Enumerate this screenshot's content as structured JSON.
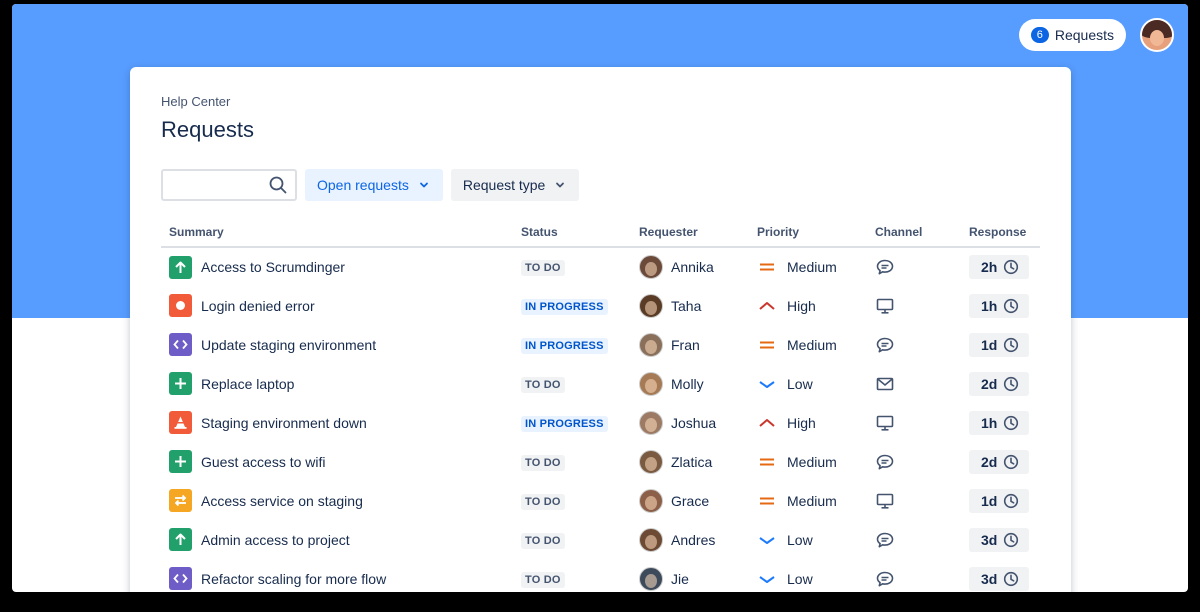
{
  "header": {
    "requests_count": "6",
    "requests_label": "Requests"
  },
  "breadcrumb": "Help Center",
  "page_title": "Requests",
  "filters": {
    "search_placeholder": "",
    "open_requests_label": "Open requests",
    "request_type_label": "Request type"
  },
  "columns": [
    "Summary",
    "Status",
    "Requester",
    "Priority",
    "Channel",
    "Response"
  ],
  "colors": {
    "hero": "#579dff",
    "accent": "#0c66e4"
  },
  "rows": [
    {
      "type_icon": "arrow-up-icon",
      "type_color": "#22a06b",
      "summary": "Access to Scrumdinger",
      "status": "TO DO",
      "status_kind": "todo",
      "requester": "Annika",
      "avatar_color": "#6b4a3a",
      "priority": "Medium",
      "channel_icon": "chat-icon",
      "response": "2h"
    },
    {
      "type_icon": "circle-icon",
      "type_color": "#f15b3a",
      "summary": "Login denied error",
      "status": "IN PROGRESS",
      "status_kind": "progress",
      "requester": "Taha",
      "avatar_color": "#5a3b26",
      "priority": "High",
      "channel_icon": "monitor-icon",
      "response": "1h"
    },
    {
      "type_icon": "code-icon",
      "type_color": "#6e5dc6",
      "summary": "Update staging environment",
      "status": "IN PROGRESS",
      "status_kind": "progress",
      "requester": "Fran",
      "avatar_color": "#8a6f5a",
      "priority": "Medium",
      "channel_icon": "chat-icon",
      "response": "1d"
    },
    {
      "type_icon": "plus-icon",
      "type_color": "#22a06b",
      "summary": "Replace laptop",
      "status": "TO DO",
      "status_kind": "todo",
      "requester": "Molly",
      "avatar_color": "#a57a55",
      "priority": "Low",
      "channel_icon": "mail-icon",
      "response": "2d"
    },
    {
      "type_icon": "cone-icon",
      "type_color": "#f15b3a",
      "summary": "Staging environment down",
      "status": "IN PROGRESS",
      "status_kind": "progress",
      "requester": "Joshua",
      "avatar_color": "#9c7a63",
      "priority": "High",
      "channel_icon": "monitor-icon",
      "response": "1h"
    },
    {
      "type_icon": "plus-icon",
      "type_color": "#22a06b",
      "summary": "Guest access to wifi",
      "status": "TO DO",
      "status_kind": "todo",
      "requester": "Zlatica",
      "avatar_color": "#7a5a40",
      "priority": "Medium",
      "channel_icon": "chat-icon",
      "response": "2d"
    },
    {
      "type_icon": "swap-icon",
      "type_color": "#f5a623",
      "summary": "Access service on staging",
      "status": "TO DO",
      "status_kind": "todo",
      "requester": "Grace",
      "avatar_color": "#8c5f48",
      "priority": "Medium",
      "channel_icon": "monitor-icon",
      "response": "1d"
    },
    {
      "type_icon": "arrow-up-icon",
      "type_color": "#22a06b",
      "summary": "Admin access to project",
      "status": "TO DO",
      "status_kind": "todo",
      "requester": "Andres",
      "avatar_color": "#6d4a33",
      "priority": "Low",
      "channel_icon": "chat-icon",
      "response": "3d"
    },
    {
      "type_icon": "code-icon",
      "type_color": "#6e5dc6",
      "summary": "Refactor scaling for more flow",
      "status": "TO DO",
      "status_kind": "todo",
      "requester": "Jie",
      "avatar_color": "#3d4a5c",
      "priority": "Low",
      "channel_icon": "chat-icon",
      "response": "3d"
    }
  ]
}
